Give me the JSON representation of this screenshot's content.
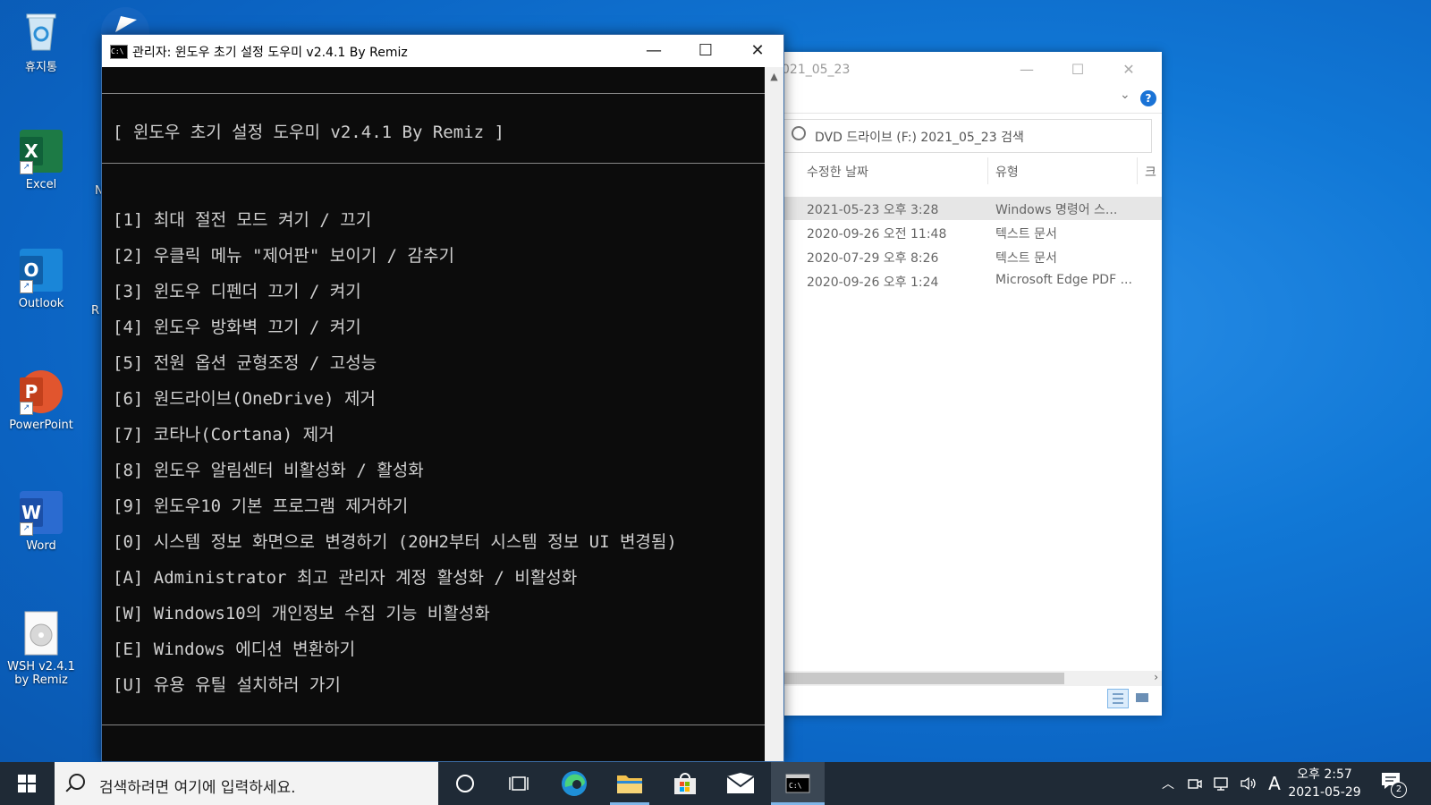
{
  "desktop": {
    "icons": [
      {
        "label": "휴지통"
      },
      {
        "label": "Excel"
      },
      {
        "label": "Outlook"
      },
      {
        "label": "PowerPoint"
      },
      {
        "label": "Word"
      },
      {
        "label_line1": "WSH v2.4.1",
        "label_line2": "by Remiz"
      }
    ],
    "partial_icon_labels": [
      "N",
      "R"
    ]
  },
  "console": {
    "title": "관리자:  윈도우 초기 설정 도우미 v2.4.1 By Remiz",
    "minimize": "—",
    "maximize": "☐",
    "close": "✕",
    "header_line": "[ 윈도우 초기 설정 도우미 v2.4.1 By Remiz ]",
    "menu": [
      "[1] 최대 절전 모드 켜기 / 끄기",
      "[2] 우클릭 메뉴 \"제어판\" 보이기 / 감추기",
      "[3] 윈도우 디펜더 끄기 / 켜기",
      "[4] 윈도우 방화벽 끄기 / 켜기",
      "[5] 전원 옵션 균형조정 / 고성능",
      "[6] 원드라이브(OneDrive) 제거",
      "[7] 코타나(Cortana) 제거",
      "[8] 윈도우 알림센터 비활성화 / 활성화",
      "[9] 윈도우10 기본 프로그램 제거하기",
      "[0] 시스템 정보 화면으로 변경하기 (20H2부터 시스템 정보 UI 변경됨)",
      "[A] Administrator 최고 관리자 계정 활성화 / 비활성화",
      "[W] Windows10의 개인정보 수집 기능 비활성화",
      "[E] Windows 에디션 변환하기",
      "[U] 유용 유틸 설치하러 가기"
    ]
  },
  "explorer": {
    "title": "021_05_23",
    "search_placeholder": "DVD 드라이브 (F:) 2021_05_23 검색",
    "columns": [
      "수정한 날짜",
      "유형",
      "크"
    ],
    "rows": [
      {
        "date": "2021-05-23 오후 3:28",
        "type": "Windows 명령어 스..."
      },
      {
        "date": "2020-09-26 오전 11:48",
        "type": "텍스트 문서"
      },
      {
        "date": "2020-07-29 오후 8:26",
        "type": "텍스트 문서"
      },
      {
        "date": "2020-09-26 오후 1:24",
        "type": "Microsoft Edge PDF ..."
      }
    ],
    "help": "?"
  },
  "taskbar": {
    "search_placeholder": "검색하려면 여기에 입력하세요.",
    "time": "오후 2:57",
    "date": "2021-05-29",
    "ime": "A",
    "notification_count": "2"
  },
  "colors": {
    "console_bg": "#0c0c0c",
    "console_text": "#d0d0d0",
    "taskbar_bg": "#1f2a36",
    "accent": "#0078d7"
  }
}
